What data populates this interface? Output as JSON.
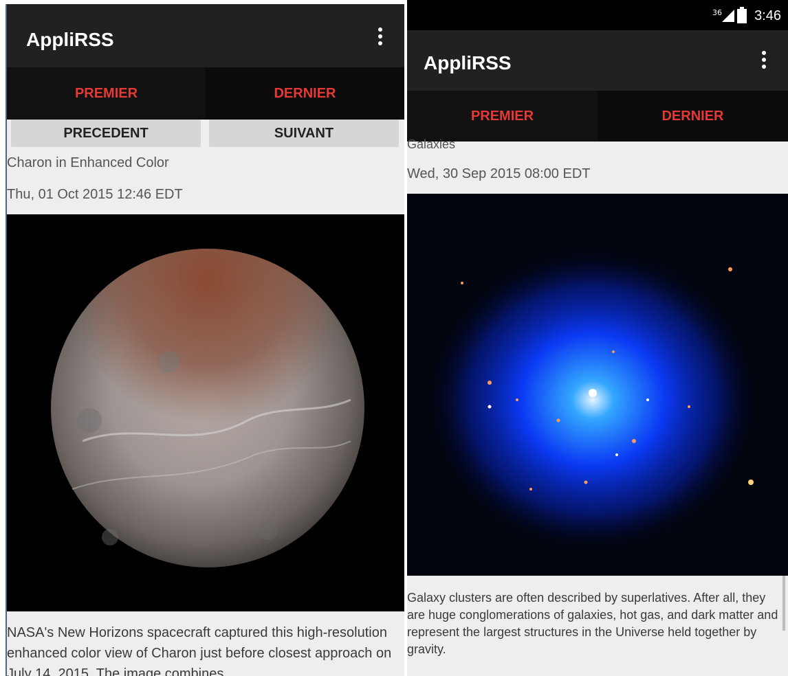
{
  "left": {
    "app_title": "AppliRSS",
    "tabs": [
      "PREMIER",
      "DERNIER"
    ],
    "nav": {
      "prev": "PRECEDENT",
      "next": "SUIVANT"
    },
    "item_title": "Charon in Enhanced Color",
    "item_date": "Thu, 01 Oct 2015 12:46 EDT",
    "description": "NASA's New Horizons spacecraft captured this high-resolution enhanced color view of Charon just before closest approach on July 14, 2015. The image combines"
  },
  "right": {
    "status": {
      "network": "36",
      "time": "3:46"
    },
    "app_title": "AppliRSS",
    "tabs": [
      "PREMIER",
      "DERNIER"
    ],
    "item_title_partial": "Galaxies",
    "item_date": "Wed, 30 Sep 2015 08:00 EDT",
    "description": "Galaxy clusters are often described by superlatives. After all, they are huge conglomerations of galaxies, hot gas, and dark matter and represent the largest structures in the Universe held together by gravity."
  },
  "colors": {
    "accent_red": "#e53935",
    "toolbar": "#212121",
    "background": "#eeeeee"
  },
  "icons": {
    "overflow": "overflow-menu-icon",
    "signal": "signal-icon",
    "battery": "battery-icon"
  }
}
